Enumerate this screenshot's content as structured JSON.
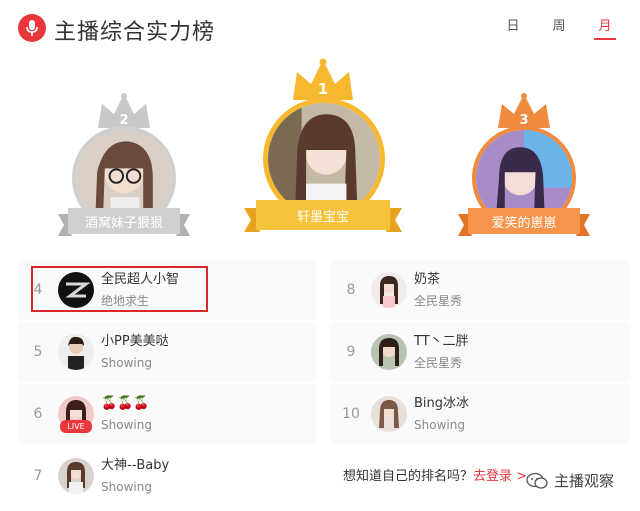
{
  "header": {
    "title": "主播综合实力榜",
    "icon": "microphone-icon",
    "accent_color": "#e8383d",
    "tabs": [
      {
        "label": "日",
        "active": false
      },
      {
        "label": "周",
        "active": false
      },
      {
        "label": "月",
        "active": true
      }
    ]
  },
  "podium": [
    {
      "rank": "2",
      "name": "酒窝妹子狠狠",
      "theme": "silver",
      "color": "#bdbdbd"
    },
    {
      "rank": "1",
      "name": "轩墨宝宝",
      "theme": "gold",
      "color": "#f5b82e"
    },
    {
      "rank": "3",
      "name": "爱笑的崽崽",
      "theme": "bronze",
      "color": "#f08a3e"
    }
  ],
  "ranking": {
    "left": [
      {
        "rank": "4",
        "name": "全民超人小智",
        "category": "绝地求生",
        "highlighted": true
      },
      {
        "rank": "5",
        "name": "小PP美美哒",
        "category": "Showing"
      },
      {
        "rank": "6",
        "name": "🍒🍒🍒",
        "category": "Showing",
        "live": true,
        "live_label": "LIVE"
      },
      {
        "rank": "7",
        "name": "大神--Baby",
        "category": "Showing"
      }
    ],
    "right": [
      {
        "rank": "8",
        "name": "奶茶",
        "category": "全民星秀"
      },
      {
        "rank": "9",
        "name": "TT丶二胖",
        "category": "全民星秀"
      },
      {
        "rank": "10",
        "name": "Bing冰冰",
        "category": "Showing"
      }
    ]
  },
  "footer": {
    "question": "想知道自己的排名吗？",
    "login_link": "去登录 >",
    "watermark": "主播观察"
  }
}
